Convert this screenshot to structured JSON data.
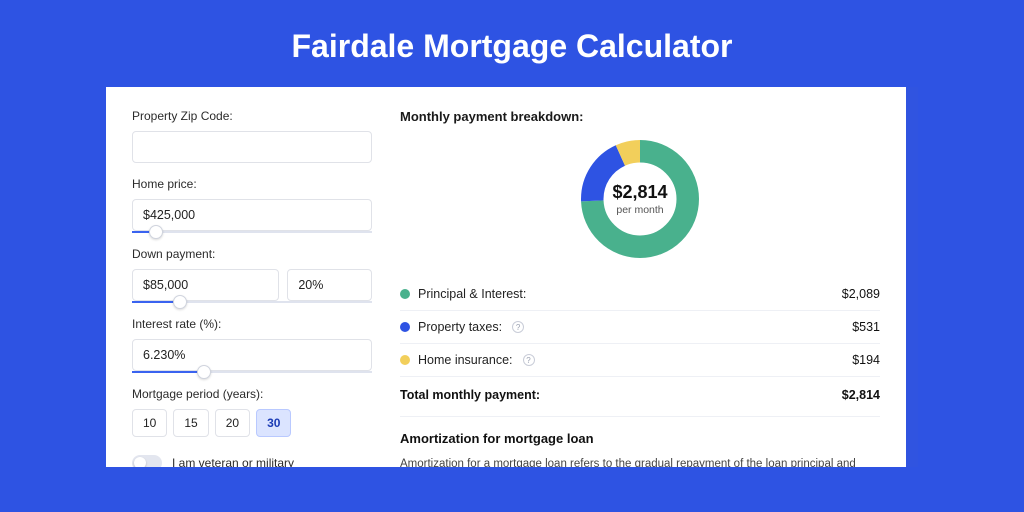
{
  "title": "Fairdale Mortgage Calculator",
  "form": {
    "zip_label": "Property Zip Code:",
    "zip_value": "",
    "home_price_label": "Home price:",
    "home_price_value": "$425,000",
    "home_price_slider_pct": 10,
    "down_payment_label": "Down payment:",
    "down_payment_value": "$85,000",
    "down_payment_pct": "20%",
    "down_payment_slider_pct": 20,
    "rate_label": "Interest rate (%):",
    "rate_value": "6.230%",
    "rate_slider_pct": 30,
    "period_label": "Mortgage period (years):",
    "periods": [
      "10",
      "15",
      "20",
      "30"
    ],
    "period_selected": "30",
    "veteran_label": "I am veteran or military"
  },
  "breakdown": {
    "title": "Monthly payment breakdown:",
    "center_amount": "$2,814",
    "center_sub": "per month",
    "items": [
      {
        "label": "Principal & Interest:",
        "value": "$2,089",
        "color": "#49b18d",
        "info": false
      },
      {
        "label": "Property taxes:",
        "value": "$531",
        "color": "#2e53e3",
        "info": true
      },
      {
        "label": "Home insurance:",
        "value": "$194",
        "color": "#f2cf5b",
        "info": true
      }
    ],
    "total_label": "Total monthly payment:",
    "total_value": "$2,814"
  },
  "chart_data": {
    "type": "pie",
    "title": "Monthly payment breakdown",
    "series": [
      {
        "name": "Principal & Interest",
        "value": 2089,
        "color": "#49b18d"
      },
      {
        "name": "Property taxes",
        "value": 531,
        "color": "#2e53e3"
      },
      {
        "name": "Home insurance",
        "value": 194,
        "color": "#f2cf5b"
      }
    ],
    "total": 2814
  },
  "amortization": {
    "title": "Amortization for mortgage loan",
    "text": "Amortization for a mortgage loan refers to the gradual repayment of the loan principal and interest over a specified"
  }
}
